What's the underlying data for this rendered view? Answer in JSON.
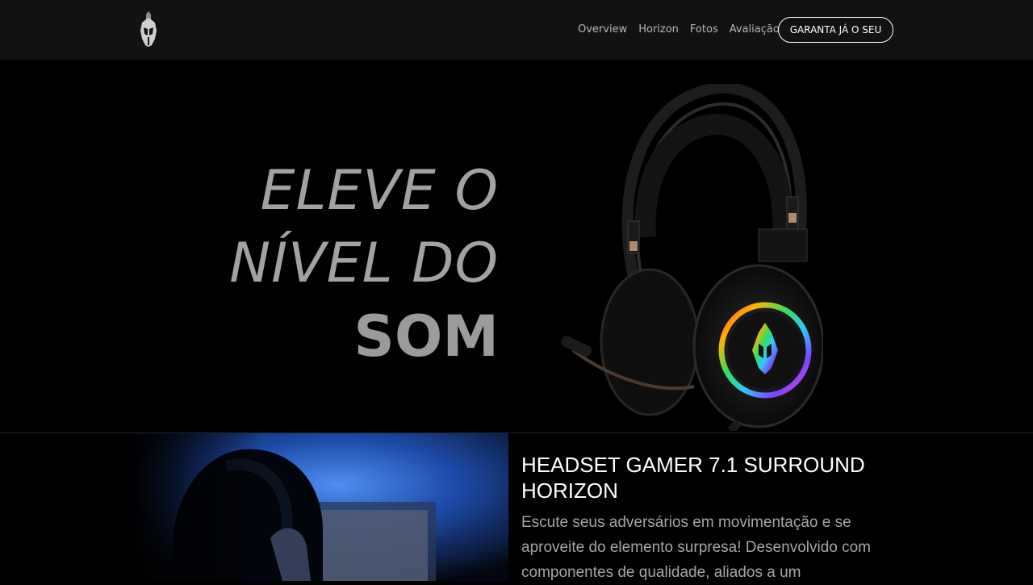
{
  "nav": {
    "links": [
      {
        "label": "Overview"
      },
      {
        "label": "Horizon"
      },
      {
        "label": "Fotos"
      },
      {
        "label": "Avaliação"
      }
    ],
    "cta_label": "GARANTA JÁ O SEU",
    "logo_icon": "spartan-helmet-icon"
  },
  "hero": {
    "line1": "ELEVE O",
    "line2": "NÍVEL DO",
    "line3": "SOM",
    "product_icon": "gaming-headset-image"
  },
  "product": {
    "title": "HEADSET GAMER 7.1 SURROUND HORIZON",
    "description": "Escute seus adversários em movimentação e se aproveite do elemento surpresa! Desenvolvido com componentes de qualidade, aliados a um"
  }
}
